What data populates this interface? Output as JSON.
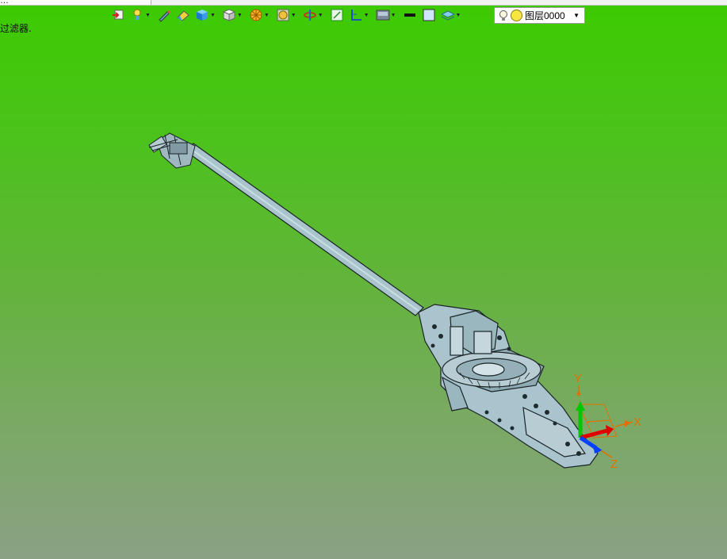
{
  "app": {
    "tab_title": "…"
  },
  "status": {
    "text": "过滤器."
  },
  "toolbar": {
    "items": [
      {
        "name": "orient-view-icon",
        "has_dropdown": false
      },
      {
        "name": "light-icon",
        "has_dropdown": true
      },
      {
        "name": "pen-icon",
        "has_dropdown": false
      },
      {
        "name": "eraser-icon",
        "has_dropdown": false
      },
      {
        "name": "shaded-solid-icon",
        "has_dropdown": true
      },
      {
        "name": "view-cube-icon",
        "has_dropdown": true
      },
      {
        "name": "section-icon",
        "has_dropdown": true
      },
      {
        "name": "render-style-icon",
        "has_dropdown": true
      },
      {
        "name": "rotate-icon",
        "has_dropdown": true
      },
      {
        "name": "fit-view-icon",
        "has_dropdown": false
      },
      {
        "name": "snap-icon",
        "has_dropdown": true
      },
      {
        "name": "background-icon",
        "has_dropdown": true
      },
      {
        "name": "line-weight-icon",
        "has_dropdown": false
      },
      {
        "name": "color-box-icon",
        "has_dropdown": false
      },
      {
        "name": "layer-icon",
        "has_dropdown": true
      }
    ]
  },
  "layer_selector": {
    "value": "图层0000"
  },
  "axes": {
    "x": "X",
    "y": "Y",
    "z": "Z"
  },
  "colors": {
    "background_top": "#3ccb00",
    "background_bottom": "#8aa184",
    "model": "#a9c4cc",
    "model_edge": "#1a2326",
    "axis_x": "#e00000",
    "axis_y": "#00c800",
    "axis_z": "#0040ff",
    "axis_label": "#e07000"
  }
}
